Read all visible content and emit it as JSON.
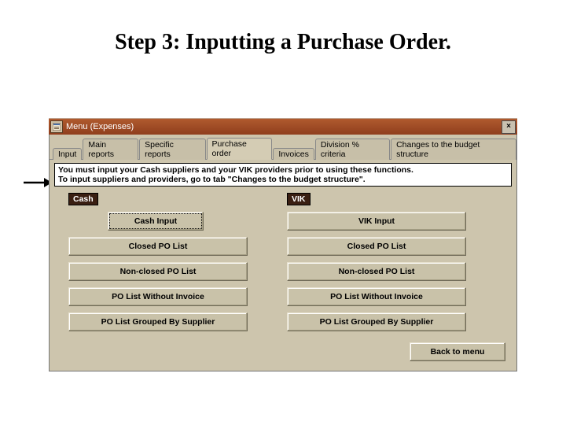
{
  "heading": "Step 3: Inputting a Purchase Order.",
  "window": {
    "title": "Menu (Expenses)"
  },
  "tabs": {
    "items": [
      "Input",
      "Main reports",
      "Specific reports",
      "Purchase order",
      "Invoices",
      "Division % criteria",
      "Changes to the budget structure"
    ]
  },
  "notice": {
    "line1": "You must input your Cash suppliers and your VIK providers prior to using these functions.",
    "line2": "To input suppliers and providers, go to tab \"Changes to the budget structure\"."
  },
  "groups": {
    "cash": {
      "label": "Cash",
      "buttons": {
        "input": "Cash Input",
        "closed": "Closed PO List",
        "nonclosed": "Non-closed PO List",
        "noinvoice": "PO List Without Invoice",
        "grouped": "PO List Grouped By Supplier"
      }
    },
    "vik": {
      "label": "VIK",
      "buttons": {
        "input": "VIK Input",
        "closed": "Closed PO List",
        "nonclosed": "Non-closed PO List",
        "noinvoice": "PO List Without Invoice",
        "grouped": "PO List Grouped By Supplier"
      }
    }
  },
  "footer": {
    "back": "Back to menu"
  }
}
